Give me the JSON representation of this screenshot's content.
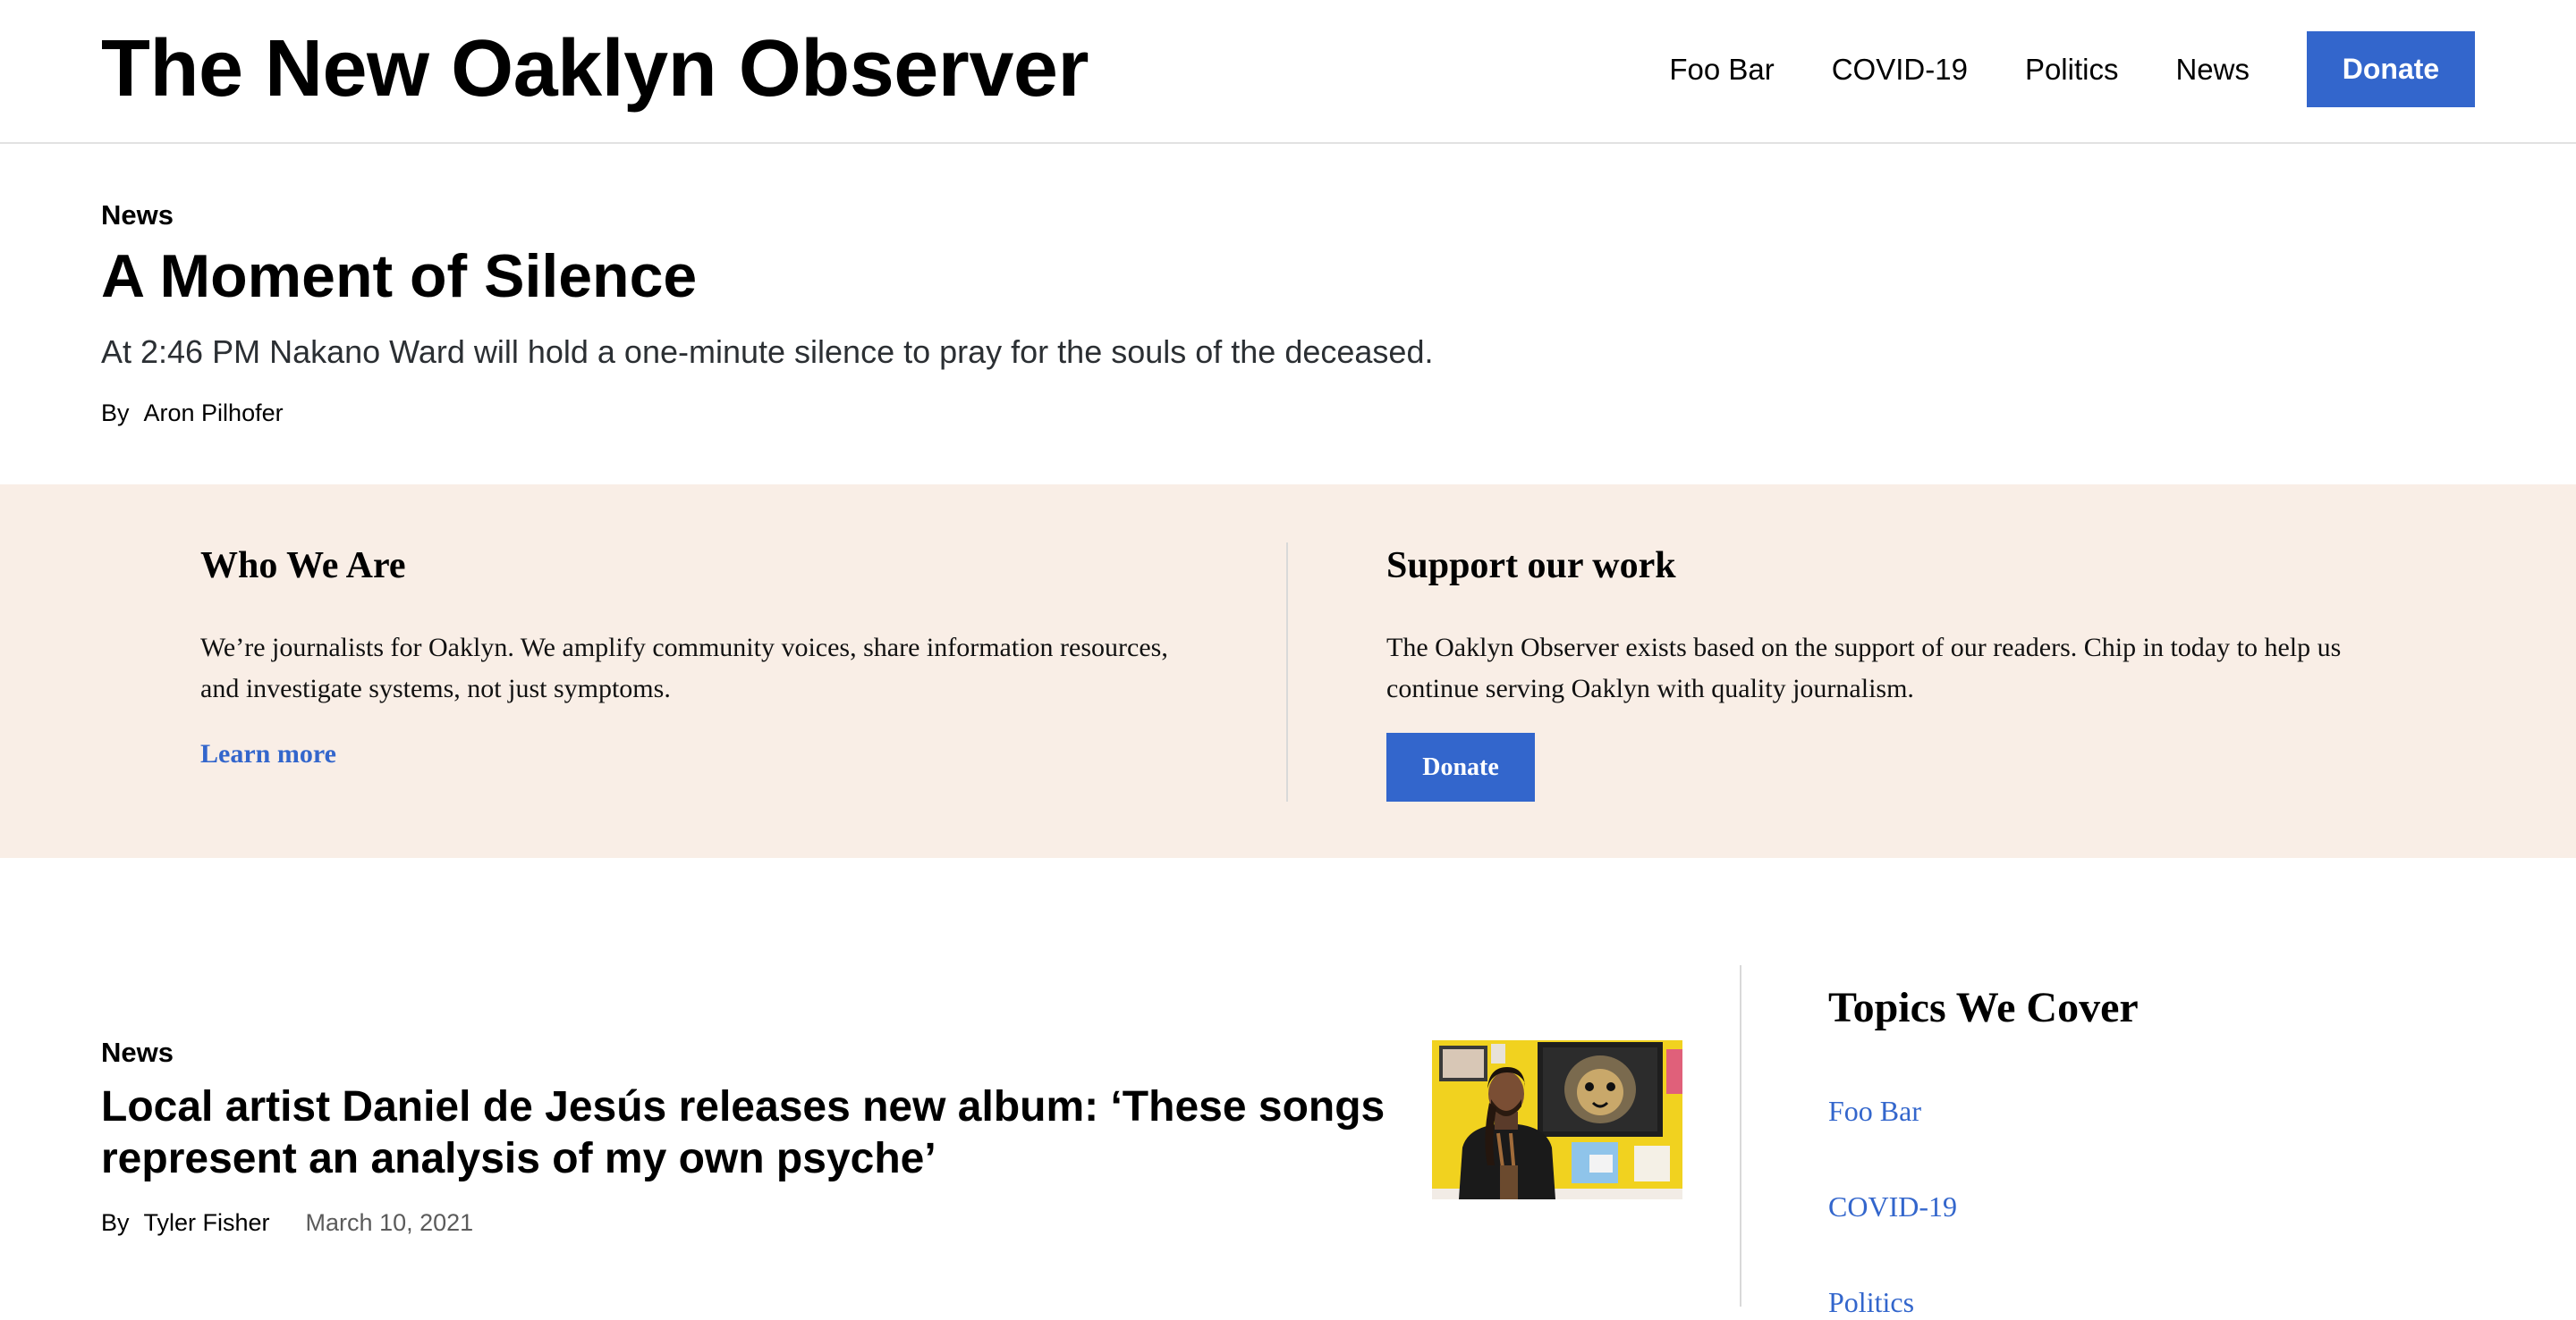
{
  "header": {
    "site_title": "The New Oaklyn Observer",
    "nav": [
      "Foo Bar",
      "COVID-19",
      "Politics",
      "News"
    ],
    "donate_label": "Donate"
  },
  "featured": {
    "category": "News",
    "headline": "A Moment of Silence",
    "dek": "At 2:46 PM Nakano Ward will hold a one-minute silence to pray for the souls of the deceased.",
    "by_label": "By",
    "author": "Aron Pilhofer"
  },
  "promo": {
    "who": {
      "title": "Who We Are",
      "text": "We’re journalists for Oaklyn. We amplify community voices, share information resources, and investigate systems, not just symptoms.",
      "link_label": "Learn more"
    },
    "support": {
      "title": "Support our work",
      "text": "The Oaklyn Observer exists based on the support of our readers. Chip in today to help us continue serving Oaklyn with quality journalism.",
      "button_label": "Donate"
    }
  },
  "story": {
    "category": "News",
    "headline": "Local artist Daniel de Jesús releases new album: ‘These songs represent an analysis of my own psyche’",
    "by_label": "By",
    "author": "Tyler Fisher",
    "date": "March 10, 2021"
  },
  "sidebar": {
    "title": "Topics We Cover",
    "topics": [
      "Foo Bar",
      "COVID-19",
      "Politics"
    ]
  },
  "colors": {
    "accent": "#3366cc",
    "promo_background": "#f9eee6",
    "rule": "#d9d9d9"
  }
}
